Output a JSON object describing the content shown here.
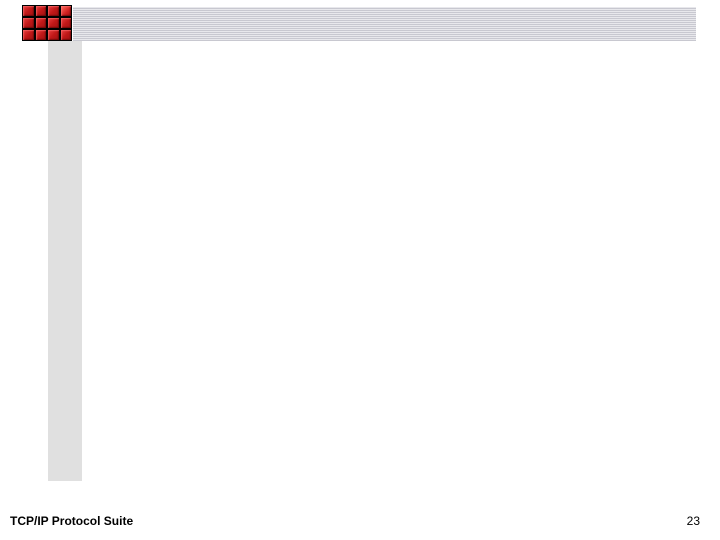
{
  "footer": {
    "title": "TCP/IP Protocol Suite",
    "page_number": "23"
  }
}
